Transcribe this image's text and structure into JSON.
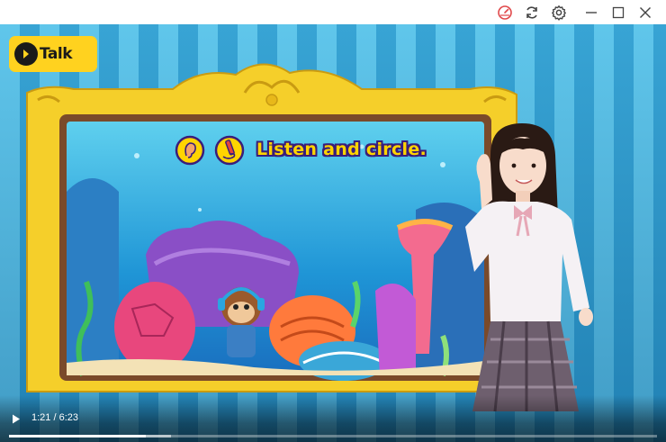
{
  "window": {
    "buttons": [
      {
        "name": "speed-icon",
        "color": "#e0484a"
      },
      {
        "name": "refresh-icon"
      },
      {
        "name": "settings-icon"
      },
      {
        "name": "minimize-icon"
      },
      {
        "name": "maximize-icon"
      },
      {
        "name": "close-icon"
      }
    ]
  },
  "logo": {
    "text": "Talk"
  },
  "lesson": {
    "instruction": "Listen and circle.",
    "icons": [
      "ear-icon",
      "pencil-icon"
    ]
  },
  "player": {
    "time": "1:21 / 6:23",
    "progress": 0.211,
    "buffered": 0.25
  },
  "colors": {
    "stripe_light": "#57c3ea",
    "stripe_dark": "#2d9fd2",
    "frame_gold": "#f5cf2a",
    "instruction_text": "#ffd400"
  }
}
